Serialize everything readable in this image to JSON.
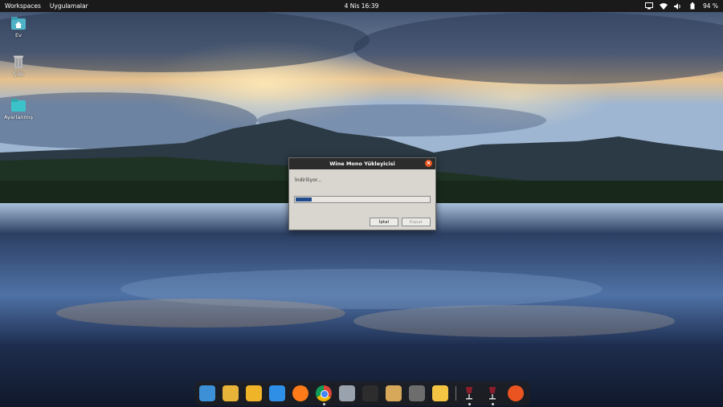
{
  "topbar": {
    "workspaces": "Workspaces",
    "applications": "Uygulamalar",
    "clock": "4 Nis  16:39",
    "battery": "94 %"
  },
  "desktop": {
    "icons": [
      {
        "label": "Ev",
        "icon": "home-folder-icon"
      },
      {
        "label": "Çöp",
        "icon": "trash-icon"
      },
      {
        "label": "Ayarlanmış",
        "icon": "folder-icon"
      }
    ]
  },
  "dialog": {
    "title": "Wine Mono Yükleyicisi",
    "status": "İndiriliyor...",
    "progress": 0.12,
    "cancel_label": "İptal",
    "close_label": "Kapat"
  },
  "dock": {
    "apps": [
      {
        "name": "search-app-icon",
        "color": "#3d8fd6"
      },
      {
        "name": "software-center-icon",
        "color": "#e8b339"
      },
      {
        "name": "app-grid-icon",
        "color": "#f0b429"
      },
      {
        "name": "vscode-icon",
        "color": "#2f8ee6"
      },
      {
        "name": "firefox-icon",
        "color": "#ff7a18"
      },
      {
        "name": "chrome-icon",
        "color": "#ffffff"
      },
      {
        "name": "files-icon",
        "color": "#9aa3ad"
      },
      {
        "name": "terminal-icon",
        "color": "#2d2d2d"
      },
      {
        "name": "archive-manager-icon",
        "color": "#d7a85a"
      },
      {
        "name": "settings-icon",
        "color": "#6d6d6d"
      },
      {
        "name": "notes-icon",
        "color": "#f4c542"
      },
      {
        "name": "wine-icon",
        "color": "#8a1f2b"
      },
      {
        "name": "wine-installer-icon",
        "color": "#8a1f2b"
      },
      {
        "name": "ubuntu-icon",
        "color": "#e95420"
      }
    ]
  }
}
